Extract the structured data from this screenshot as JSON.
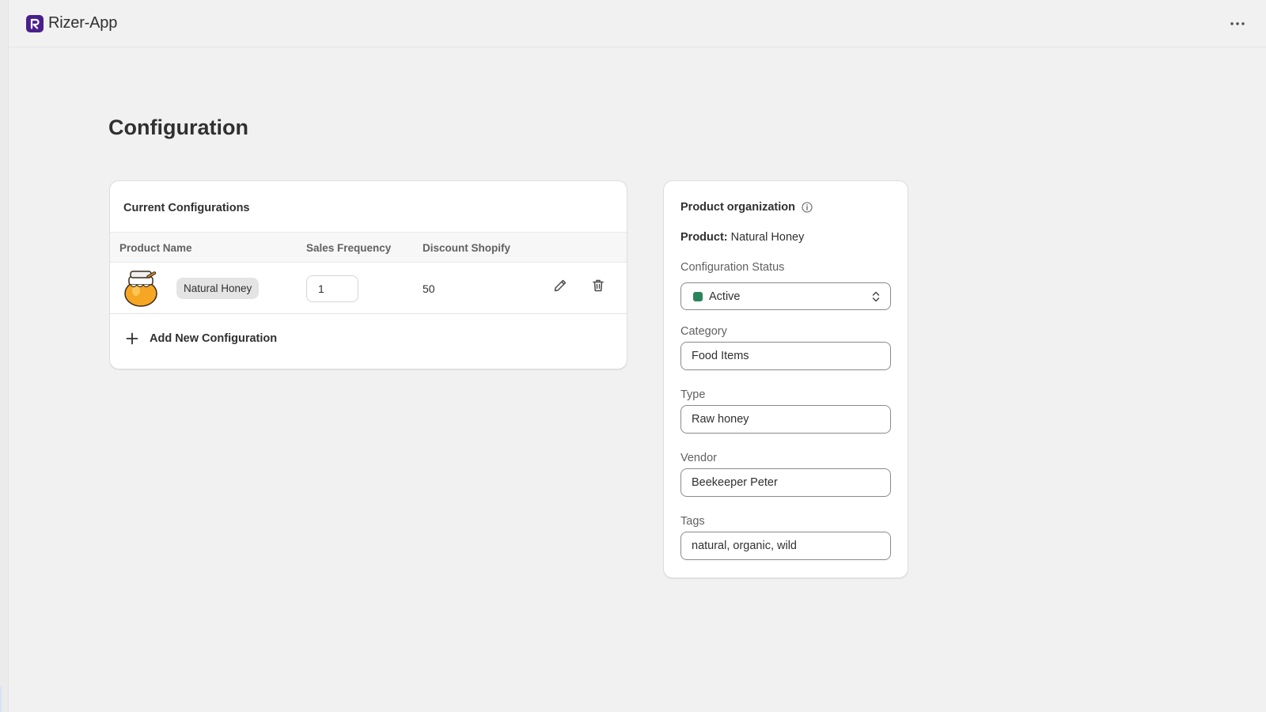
{
  "app": {
    "name": "Rizer-App",
    "more_label": "•••"
  },
  "page": {
    "title": "Configuration"
  },
  "configurations": {
    "title": "Current Configurations",
    "columns": [
      "Product Name",
      "Sales Frequency",
      "Discount Shopify"
    ],
    "rows": [
      {
        "product_name": "Natural Honey",
        "sales_frequency": "1",
        "discount_shopify": "50"
      }
    ],
    "add_label": "Add New Configuration"
  },
  "organization": {
    "title": "Product organization",
    "product_label": "Product:",
    "product_value": "Natural Honey",
    "status_label": "Configuration Status",
    "status_value": "Active",
    "status_color": "#29845a",
    "category_label": "Category",
    "category_value": "Food Items",
    "type_label": "Type",
    "type_value": "Raw honey",
    "vendor_label": "Vendor",
    "vendor_value": "Beekeeper Peter",
    "tags_label": "Tags",
    "tags_value": "natural, organic, wild"
  },
  "colors": {
    "brand": "#4a1f8c",
    "background": "#f1f1f1",
    "card": "#ffffff"
  }
}
